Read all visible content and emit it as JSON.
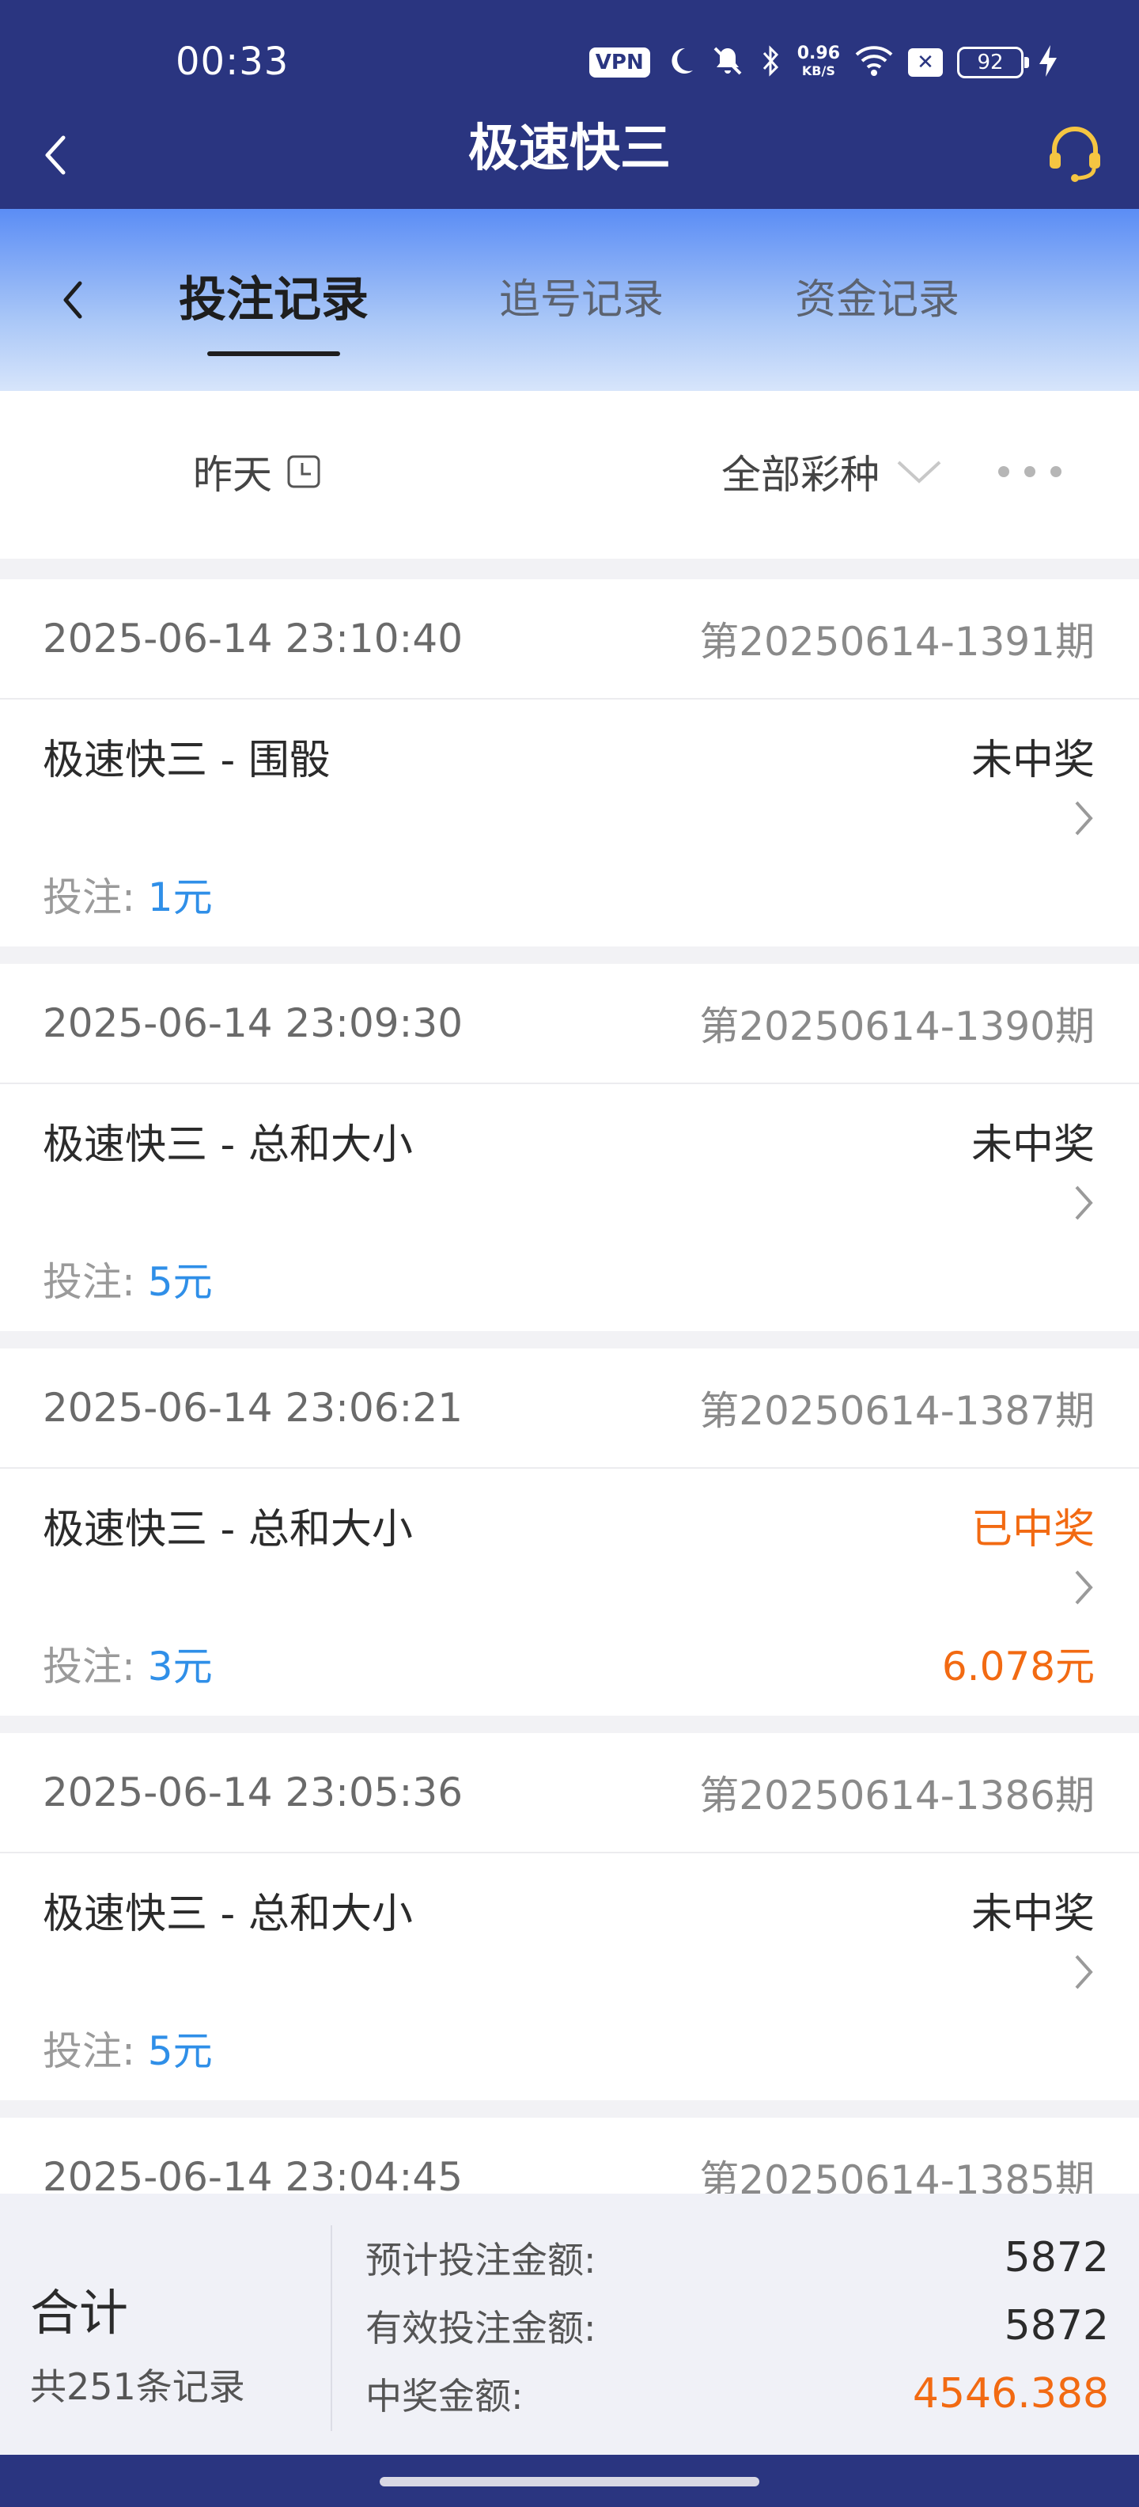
{
  "status_bar": {
    "time": "00:33",
    "vpn": "VPN",
    "net_speed_value": "0.96",
    "net_speed_unit": "KB/S",
    "battery": "92"
  },
  "header": {
    "title": "极速快三",
    "back_icon": "chevron-left-icon",
    "support_icon": "headset-icon"
  },
  "tabs": {
    "items": [
      {
        "label": "投注记录",
        "active": true
      },
      {
        "label": "追号记录",
        "active": false
      },
      {
        "label": "资金记录",
        "active": false
      }
    ]
  },
  "filters": {
    "date": "昨天",
    "lottery_type": "全部彩种"
  },
  "records": [
    {
      "datetime": "2025-06-14 23:10:40",
      "period": "第20250614-1391期",
      "game": "极速快三 - 围骰",
      "result": "未中奖",
      "won": false,
      "stake_label": "投注:",
      "stake": "1元",
      "prize": ""
    },
    {
      "datetime": "2025-06-14 23:09:30",
      "period": "第20250614-1390期",
      "game": "极速快三 - 总和大小",
      "result": "未中奖",
      "won": false,
      "stake_label": "投注:",
      "stake": "5元",
      "prize": ""
    },
    {
      "datetime": "2025-06-14 23:06:21",
      "period": "第20250614-1387期",
      "game": "极速快三 - 总和大小",
      "result": "已中奖",
      "won": true,
      "stake_label": "投注:",
      "stake": "3元",
      "prize": "6.078元"
    },
    {
      "datetime": "2025-06-14 23:05:36",
      "period": "第20250614-1386期",
      "game": "极速快三 - 总和大小",
      "result": "未中奖",
      "won": false,
      "stake_label": "投注:",
      "stake": "5元",
      "prize": ""
    },
    {
      "datetime": "2025-06-14 23:04:45",
      "period": "第20250614-1385期"
    }
  ],
  "summary": {
    "title": "合计",
    "count": "共251条记录",
    "expected_bet_label": "预计投注金额:",
    "expected_bet": "5872",
    "valid_bet_label": "有效投注金额:",
    "valid_bet": "5872",
    "prize_label": "中奖金额:",
    "prize": "4546.388"
  },
  "colors": {
    "header_bg": "#2a3580",
    "win": "#f26a12",
    "stake": "#2f8fe8"
  }
}
